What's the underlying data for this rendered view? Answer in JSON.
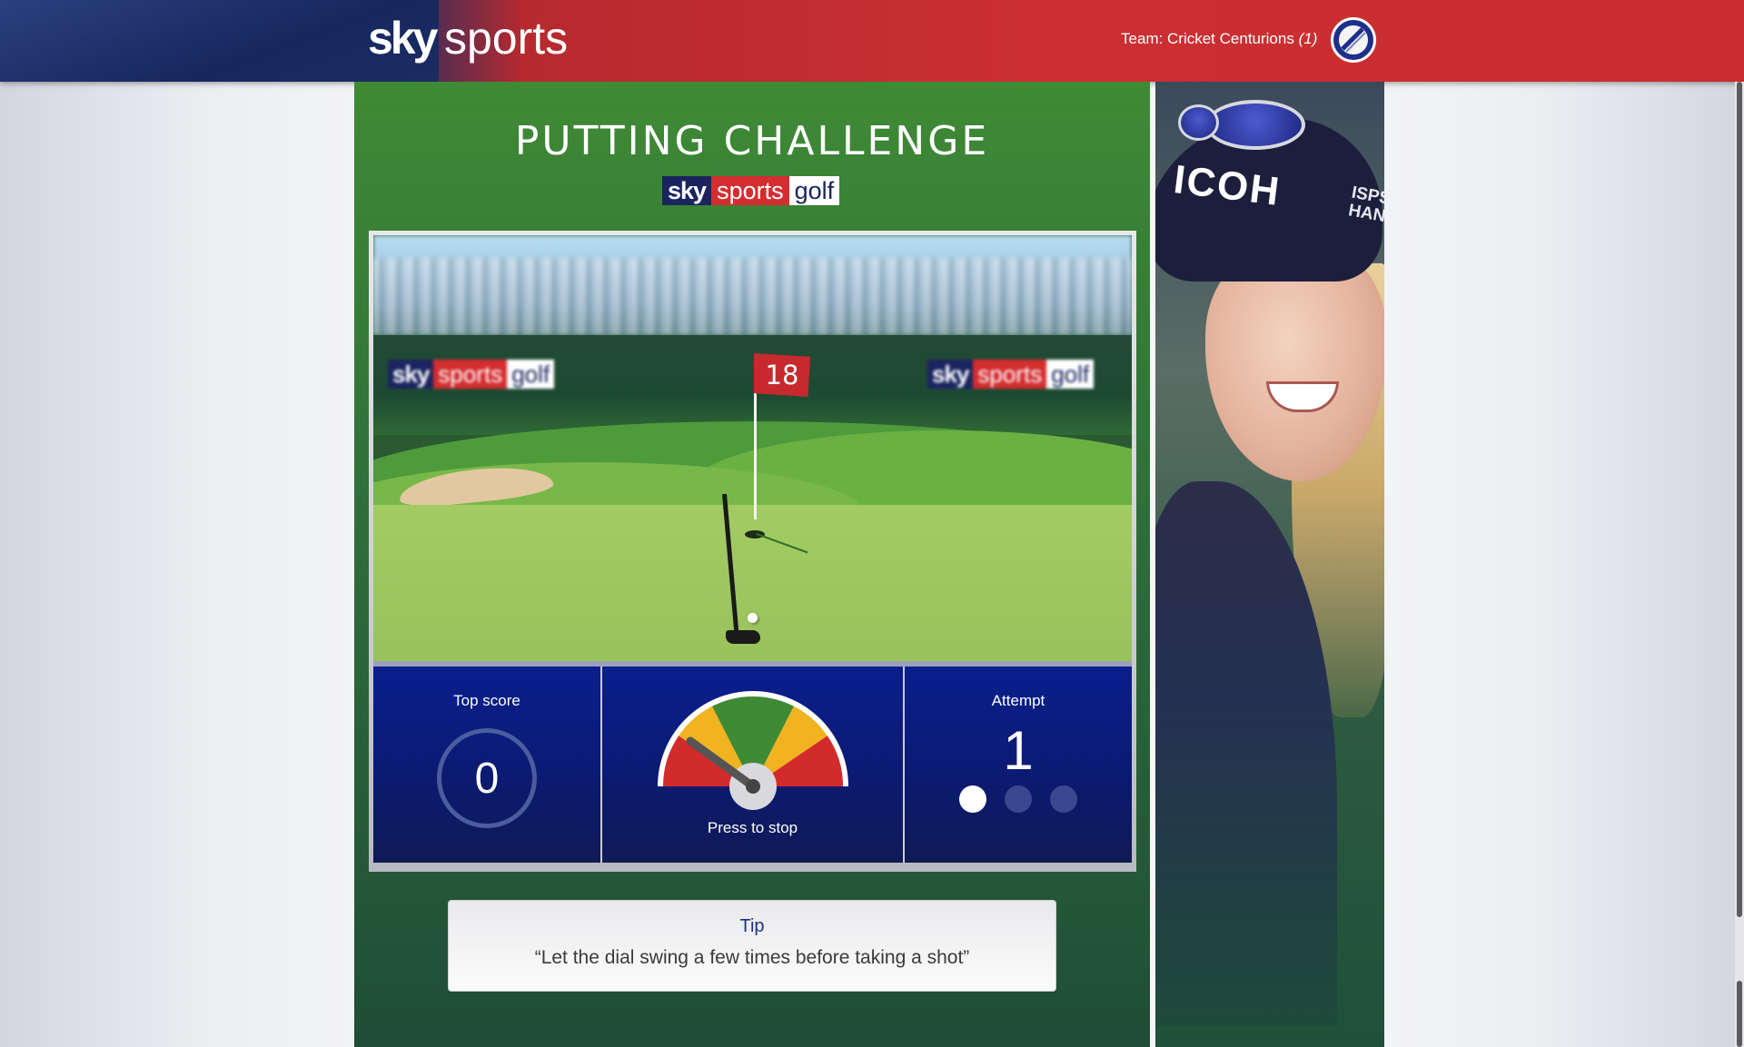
{
  "header": {
    "logo_sky": "sky",
    "logo_sports": "sports",
    "team_label": "Team: Cricket Centurions",
    "team_count": "(1)",
    "badge_icon": "cricket-ball-icon",
    "colors": {
      "blue": "#1c2d64",
      "red": "#cc2f32"
    }
  },
  "game": {
    "title": "PUTTING CHALLENGE",
    "sponsor_logo": {
      "sky": "sky",
      "sports": "sports",
      "golf": "golf"
    },
    "scene": {
      "flag_number": "18",
      "board_left": {
        "sky": "sky",
        "sports": "sports",
        "golf": "golf"
      },
      "board_right": {
        "sky": "sky",
        "sports": "sports",
        "golf": "golf"
      }
    },
    "top_score": {
      "label": "Top score",
      "value": "0"
    },
    "dial": {
      "action_label": "Press to stop",
      "zones": [
        "red",
        "yellow",
        "green",
        "yellow",
        "red"
      ]
    },
    "attempt": {
      "label": "Attempt",
      "value": "1",
      "total_dots": 3,
      "current": 1
    },
    "colors": {
      "panel_blue": "#0a1f8e",
      "green_bg": "#3f8a35"
    }
  },
  "tip": {
    "title": "Tip",
    "text": "“Let the dial swing a few times before taking a shot”"
  },
  "side_photo": {
    "cap_text": "ICOH",
    "cap_text_side": "ISPS HAN"
  }
}
